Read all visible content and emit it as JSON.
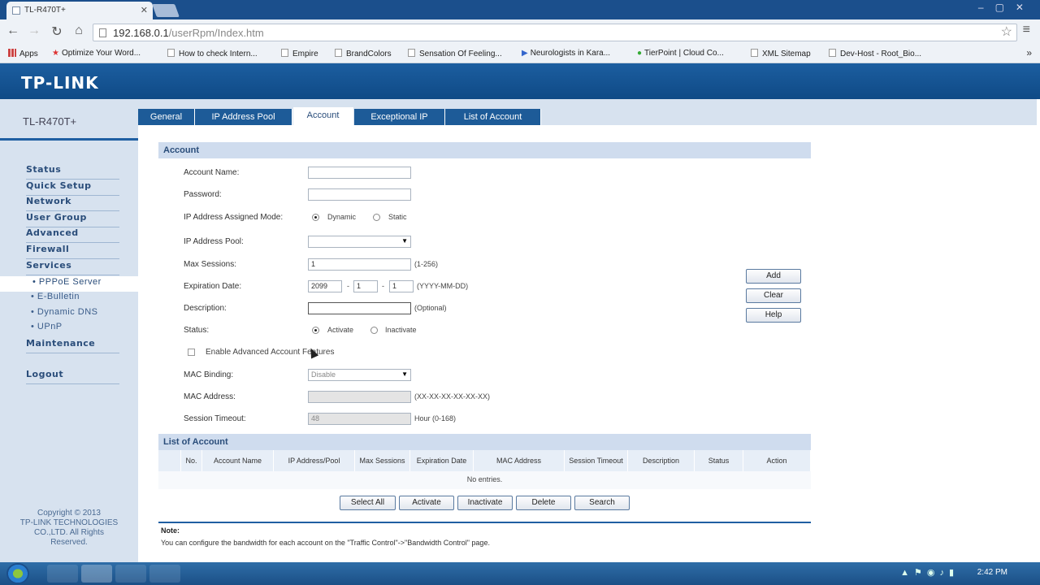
{
  "browser": {
    "tab_title": "TL-R470T+",
    "url_host": "192.168.0.1",
    "url_path": "/userRpm/Index.htm",
    "bookmarks": [
      "Apps",
      "Optimize Your Word...",
      "How to check Intern...",
      "Empire",
      "BrandColors",
      "Sensation Of Feeling...",
      "Neurologists in Kara...",
      "TierPoint | Cloud Co...",
      "XML Sitemap",
      "Dev-Host - Root_Bio..."
    ]
  },
  "brand": {
    "logo": "TP-LINK",
    "model": "TL-R470T+"
  },
  "sidebar": {
    "items": [
      "Status",
      "Quick Setup",
      "Network",
      "User Group",
      "Advanced",
      "Firewall",
      "Services"
    ],
    "sub_items": [
      "• PPPoE Server",
      "• E-Bulletin",
      "• Dynamic DNS",
      "• UPnP"
    ],
    "maintenance": "Maintenance",
    "logout": "Logout",
    "copyright": [
      "Copyright © 2013",
      "TP-LINK TECHNOLOGIES",
      "CO.,LTD. All Rights",
      "Reserved."
    ]
  },
  "tabs": [
    "General",
    "IP Address Pool",
    "Account",
    "Exceptional IP",
    "List of Account"
  ],
  "form": {
    "section_title": "Account",
    "account_name_label": "Account Name:",
    "account_name_value": "",
    "password_label": "Password:",
    "password_value": "",
    "ip_mode_label": "IP Address Assigned Mode:",
    "ip_mode_dynamic": "Dynamic",
    "ip_mode_static": "Static",
    "ip_pool_label": "IP Address Pool:",
    "ip_pool_value": "",
    "max_sessions_label": "Max Sessions:",
    "max_sessions_value": "1",
    "max_sessions_hint": "(1-256)",
    "expiration_label": "Expiration Date:",
    "exp_year": "2099",
    "exp_month": "1",
    "exp_day": "1",
    "exp_hint": "(YYYY-MM-DD)",
    "description_label": "Description:",
    "description_value": "",
    "description_hint": "(Optional)",
    "status_label": "Status:",
    "status_activate": "Activate",
    "status_inactivate": "Inactivate",
    "advanced_label": "Enable Advanced Account Features",
    "mac_binding_label": "MAC Binding:",
    "mac_binding_value": "Disable",
    "mac_address_label": "MAC Address:",
    "mac_address_value": "",
    "mac_address_hint": "(XX-XX-XX-XX-XX-XX)",
    "session_timeout_label": "Session Timeout:",
    "session_timeout_value": "48",
    "session_timeout_hint": "Hour (0-168)"
  },
  "side_buttons": {
    "add": "Add",
    "clear": "Clear",
    "help": "Help"
  },
  "list": {
    "section_title": "List of Account",
    "columns": [
      "No.",
      "Account Name",
      "IP Address/Pool",
      "Max Sessions",
      "Expiration Date",
      "MAC Address",
      "Session Timeout",
      "Description",
      "Status",
      "Action"
    ],
    "empty_text": "No entries."
  },
  "list_buttons": [
    "Select All",
    "Activate",
    "Inactivate",
    "Delete",
    "Search"
  ],
  "note": {
    "title": "Note:",
    "text": "You can configure the bandwidth for each account on the \"Traffic Control\"->\"Bandwidth Control\" page."
  },
  "taskbar": {
    "time": "2:42 PM"
  },
  "colors": {
    "brand_blue": "#1c5ea0",
    "sidebar_bg": "#d7e2ef",
    "section_bg": "#cfdcee"
  }
}
